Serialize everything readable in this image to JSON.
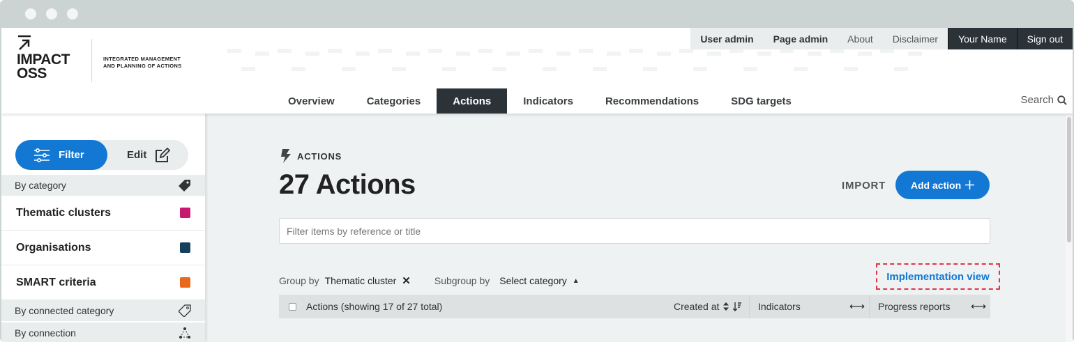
{
  "brand": {
    "name_line1": "IMPACT",
    "name_line2": "OSS",
    "tagline_line1": "INTEGRATED MANAGEMENT",
    "tagline_line2": "AND PLANNING OF ACTIONS"
  },
  "topnav": {
    "user_admin": "User admin",
    "page_admin": "Page admin",
    "about": "About",
    "disclaimer": "Disclaimer",
    "user_name": "Your Name",
    "sign_out": "Sign out"
  },
  "mainnav": {
    "items": [
      "Overview",
      "Categories",
      "Actions",
      "Indicators",
      "Recommendations",
      "SDG targets"
    ],
    "active": "Actions",
    "search": "Search"
  },
  "sidebar": {
    "filter_label": "Filter",
    "edit_label": "Edit",
    "by_category": "By category",
    "categories": [
      {
        "label": "Thematic clusters",
        "color": "#c7196f"
      },
      {
        "label": "Organisations",
        "color": "#17405e"
      },
      {
        "label": "SMART criteria",
        "color": "#e8681c"
      }
    ],
    "by_connected_category": "By connected category",
    "by_connection": "By connection"
  },
  "main": {
    "eyebrow": "ACTIONS",
    "title": "27 Actions",
    "import_label": "IMPORT",
    "add_label": "Add action",
    "filter_placeholder": "Filter items by reference or title",
    "group_by_label": "Group by",
    "group_by_value": "Thematic cluster",
    "subgroup_label": "Subgroup by",
    "subgroup_value": "Select category",
    "implementation_view": "Implementation view",
    "table": {
      "actions_header": "Actions (showing 17 of 27 total)",
      "created_at": "Created at",
      "indicators": "Indicators",
      "progress_reports": "Progress reports"
    }
  },
  "colors": {
    "primary": "#1278d3",
    "dark": "#2b3338",
    "highlight_border": "#e0344c"
  }
}
